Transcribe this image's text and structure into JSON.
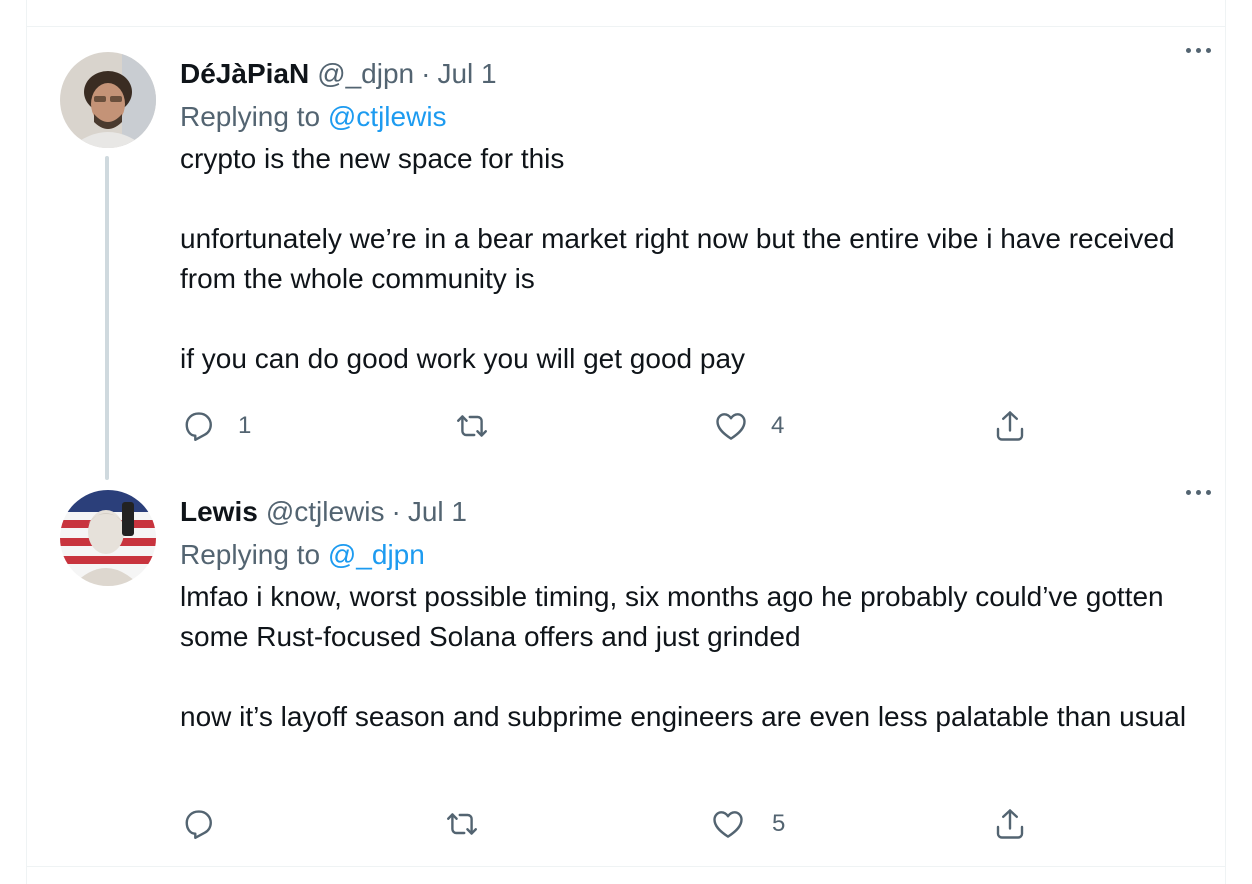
{
  "tweets": [
    {
      "display_name": "DéJàPiaN",
      "handle": "@_djpn",
      "separator": "·",
      "date": "Jul 1",
      "replying_prefix": "Replying to",
      "replying_to": "@ctjlewis",
      "paragraphs": [
        "crypto is the new space for this",
        "unfortunately we’re in a bear market right now but the entire vibe i have received from the whole community is",
        "if you can do good work you will get good pay"
      ],
      "reply_count": "1",
      "retweet_count": "",
      "like_count": "4"
    },
    {
      "display_name": "Lewis",
      "handle": "@ctjlewis",
      "separator": "·",
      "date": "Jul 1",
      "replying_prefix": "Replying to",
      "replying_to": "@_djpn",
      "paragraphs": [
        "lmfao i know, worst possible timing, six months ago he probably could’ve gotten some Rust-focused Solana offers and just grinded",
        "now it’s layoff season and subprime engineers are even less palatable than usual"
      ],
      "reply_count": "",
      "retweet_count": "",
      "like_count": "5"
    }
  ],
  "icons": {
    "reply": "reply-icon",
    "retweet": "retweet-icon",
    "like": "heart-icon",
    "share": "share-icon",
    "more": "more-icon"
  },
  "colors": {
    "link": "#1d9bf0",
    "secondary_text": "#536471",
    "primary_text": "#0f1419",
    "thread_line": "#cfd9de"
  }
}
